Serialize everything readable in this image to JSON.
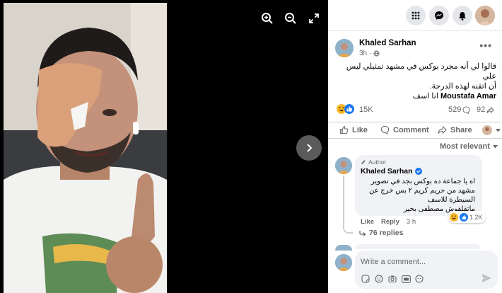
{
  "viewer": {
    "zoom_in_icon": "zoom-in-icon",
    "zoom_out_icon": "zoom-out-icon",
    "fullscreen_icon": "fullscreen-icon",
    "next_icon": "chevron-right-icon"
  },
  "topbar": {
    "icons": [
      "menu-grid-icon",
      "messenger-icon",
      "notifications-bell-icon",
      "profile-avatar"
    ]
  },
  "post": {
    "author": "Khaled Sarhan",
    "time": "3h",
    "audience_icon": "globe-icon",
    "more_label": "•••",
    "text_line1": "قالوا لي أنه مجرد بوكس في مشهد تمثيلي ليس علي",
    "text_line2": "أن اتقنه لهذه الدرجة.",
    "mention": "Moustafa Amar",
    "text_line3_suffix": " انا اسف",
    "reaction_count": "15K",
    "comments_count": "529",
    "shares_count": "92",
    "reactions": [
      "haha",
      "like"
    ]
  },
  "actions": {
    "like": "Like",
    "comment": "Comment",
    "share": "Share"
  },
  "sort": {
    "label": "Most relevant"
  },
  "comment": {
    "badge": "Author",
    "author": "Khaled Sarhan",
    "verified": true,
    "line1": "اه يا جماعة ده بوكس بجد في تصوير",
    "line2": "مشهد من حريم كريم ٢ بس خرج عن",
    "line3": "السيطرة للاسف",
    "line4": "ماتقلقوش مصطفى بخير",
    "reaction_count": "1.2K",
    "like_label": "Like",
    "reply_label": "Reply",
    "time": "3 h",
    "replies_label": "76 replies"
  },
  "composer": {
    "placeholder": "Write a comment...",
    "tools": [
      "sticker-icon",
      "emoji-icon",
      "camera-icon",
      "gif-icon",
      "sticker-face-icon"
    ]
  },
  "colors": {
    "brand_blue": "#1877f2",
    "muted": "#65676b",
    "bubble": "#f0f2f5"
  }
}
